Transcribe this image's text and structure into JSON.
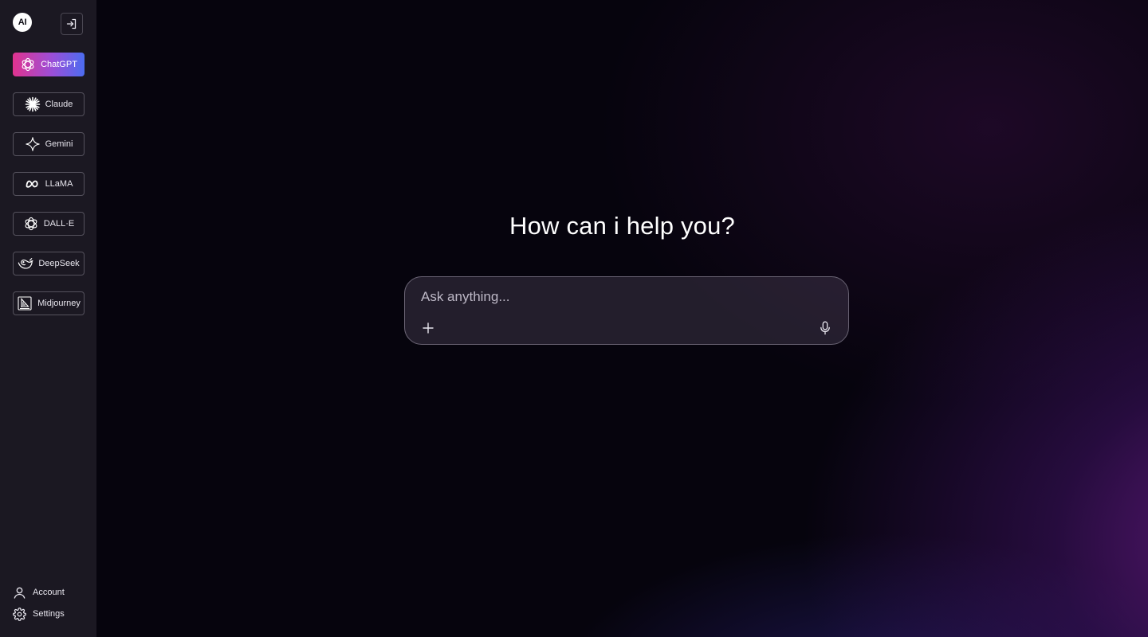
{
  "brand": {
    "logo_text": "AI"
  },
  "sidebar": {
    "collapse_icon": "sign-in-icon",
    "models": [
      {
        "label": "ChatGPT",
        "icon": "openai-icon",
        "active": true
      },
      {
        "label": "Claude",
        "icon": "claude-sunburst-icon",
        "active": false
      },
      {
        "label": "Gemini",
        "icon": "gemini-sparkle-icon",
        "active": false
      },
      {
        "label": "LLaMA",
        "icon": "meta-infinity-icon",
        "active": false
      },
      {
        "label": "DALL·E",
        "icon": "openai-icon",
        "active": false
      },
      {
        "label": "DeepSeek",
        "icon": "deepseek-whale-icon",
        "active": false
      },
      {
        "label": "Midjourney",
        "icon": "midjourney-sail-icon",
        "active": false
      }
    ],
    "footer": {
      "account_label": "Account",
      "settings_label": "Settings"
    }
  },
  "main": {
    "headline": "How can i help you?",
    "prompt": {
      "placeholder": "Ask anything...",
      "value": ""
    }
  },
  "colors": {
    "sidebar_bg": "#1b1822",
    "active_gradient_start": "#e0338f",
    "active_gradient_end": "#4b6cf0",
    "main_bg": "#06040d",
    "glow": "#781e96"
  }
}
